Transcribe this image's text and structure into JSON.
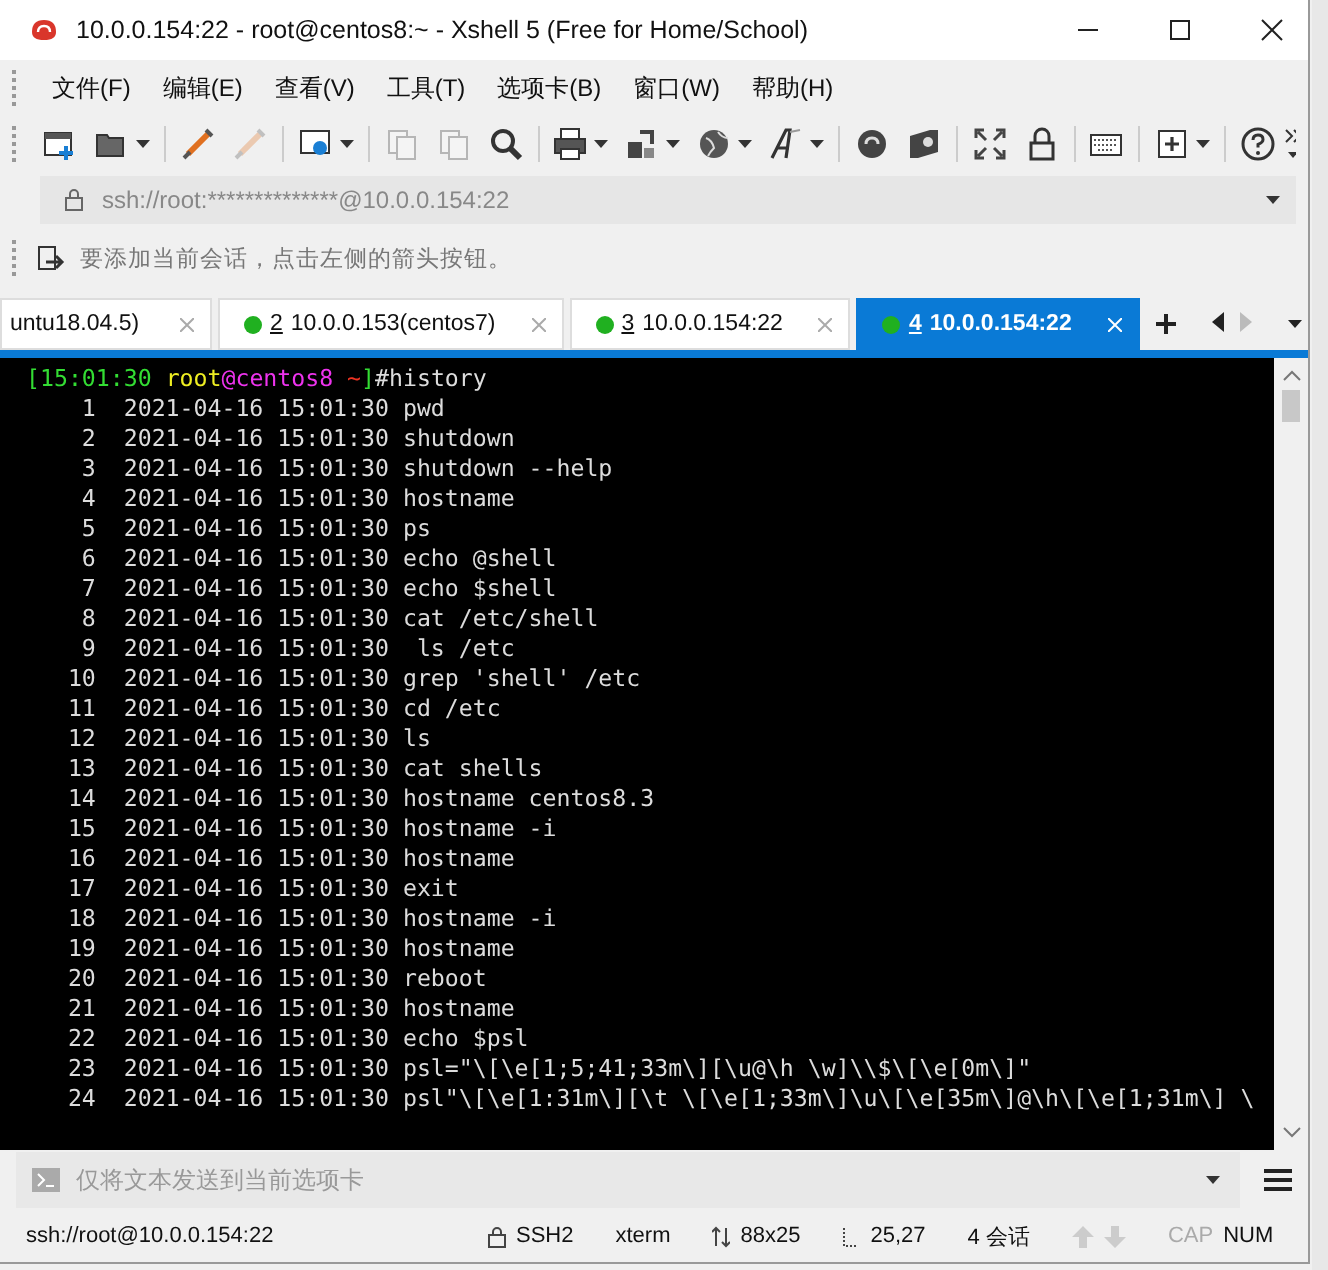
{
  "window": {
    "title": "10.0.0.154:22 - root@centos8:~ - Xshell 5 (Free for Home/School)"
  },
  "menu": [
    "文件(F)",
    "编辑(E)",
    "查看(V)",
    "工具(T)",
    "选项卡(B)",
    "窗口(W)",
    "帮助(H)"
  ],
  "toolbar": [
    {
      "kind": "new",
      "caret": false,
      "disabled": false
    },
    {
      "kind": "open",
      "caret": true,
      "disabled": false
    },
    {
      "kind": "sep"
    },
    {
      "kind": "connect",
      "caret": false,
      "disabled": false
    },
    {
      "kind": "disconnect",
      "caret": false,
      "disabled": true
    },
    {
      "kind": "sep"
    },
    {
      "kind": "properties",
      "caret": true,
      "disabled": false
    },
    {
      "kind": "sep"
    },
    {
      "kind": "copy",
      "caret": false,
      "disabled": true
    },
    {
      "kind": "paste",
      "caret": false,
      "disabled": true
    },
    {
      "kind": "find",
      "caret": false,
      "disabled": false
    },
    {
      "kind": "sep"
    },
    {
      "kind": "print",
      "caret": true,
      "disabled": false
    },
    {
      "kind": "transfer",
      "caret": true,
      "disabled": false
    },
    {
      "kind": "globe",
      "caret": true,
      "disabled": false
    },
    {
      "kind": "font",
      "caret": true,
      "disabled": false
    },
    {
      "kind": "sep"
    },
    {
      "kind": "shell",
      "caret": false,
      "disabled": false
    },
    {
      "kind": "xftp",
      "caret": false,
      "disabled": false
    },
    {
      "kind": "sep"
    },
    {
      "kind": "fullscreen",
      "caret": false,
      "disabled": false
    },
    {
      "kind": "lock",
      "caret": false,
      "disabled": false
    },
    {
      "kind": "sep"
    },
    {
      "kind": "keyboard",
      "caret": false,
      "disabled": false
    },
    {
      "kind": "sep"
    },
    {
      "kind": "newtab",
      "caret": true,
      "disabled": false
    },
    {
      "kind": "sep"
    },
    {
      "kind": "help",
      "caret": false,
      "disabled": false
    }
  ],
  "address_bar": {
    "value": "ssh://root:**************@10.0.0.154:22"
  },
  "hint_bar": {
    "text": "要添加当前会话，点击左侧的箭头按钮。"
  },
  "tabs": [
    {
      "label": "untu18.04.5)",
      "selected": false,
      "connected": false
    },
    {
      "number": "2",
      "label": "10.0.0.153(centos7)",
      "selected": false,
      "connected": true
    },
    {
      "number": "3",
      "label": "10.0.0.154:22",
      "selected": false,
      "connected": true
    },
    {
      "number": "4",
      "label": "10.0.0.154:22",
      "selected": true,
      "connected": true
    }
  ],
  "terminal": {
    "prompt": [
      {
        "text": "[15:01:30 ",
        "color": "#33dd33"
      },
      {
        "text": "root",
        "color": "#eeee22"
      },
      {
        "text": "@centos8",
        "color": "#ee33ee"
      },
      {
        "text": " ~",
        "color": "#ee3322"
      },
      {
        "text": "]",
        "color": "#33dd33"
      },
      {
        "text": "#history",
        "color": "#dddddd"
      }
    ],
    "rows": [
      {
        "number": "1",
        "timestamp": "2021-04-16 15:01:30",
        "command": "pwd"
      },
      {
        "number": "2",
        "timestamp": "2021-04-16 15:01:30",
        "command": "shutdown"
      },
      {
        "number": "3",
        "timestamp": "2021-04-16 15:01:30",
        "command": "shutdown --help"
      },
      {
        "number": "4",
        "timestamp": "2021-04-16 15:01:30",
        "command": "hostname"
      },
      {
        "number": "5",
        "timestamp": "2021-04-16 15:01:30",
        "command": "ps"
      },
      {
        "number": "6",
        "timestamp": "2021-04-16 15:01:30",
        "command": "echo @shell"
      },
      {
        "number": "7",
        "timestamp": "2021-04-16 15:01:30",
        "command": "echo $shell"
      },
      {
        "number": "8",
        "timestamp": "2021-04-16 15:01:30",
        "command": "cat /etc/shell"
      },
      {
        "number": "9",
        "timestamp": "2021-04-16 15:01:30",
        "command": " ls /etc"
      },
      {
        "number": "10",
        "timestamp": "2021-04-16 15:01:30",
        "command": "grep 'shell' /etc"
      },
      {
        "number": "11",
        "timestamp": "2021-04-16 15:01:30",
        "command": "cd /etc"
      },
      {
        "number": "12",
        "timestamp": "2021-04-16 15:01:30",
        "command": "ls"
      },
      {
        "number": "13",
        "timestamp": "2021-04-16 15:01:30",
        "command": "cat shells"
      },
      {
        "number": "14",
        "timestamp": "2021-04-16 15:01:30",
        "command": "hostname centos8.3"
      },
      {
        "number": "15",
        "timestamp": "2021-04-16 15:01:30",
        "command": "hostname -i"
      },
      {
        "number": "16",
        "timestamp": "2021-04-16 15:01:30",
        "command": "hostname"
      },
      {
        "number": "17",
        "timestamp": "2021-04-16 15:01:30",
        "command": "exit"
      },
      {
        "number": "18",
        "timestamp": "2021-04-16 15:01:30",
        "command": "hostname -i"
      },
      {
        "number": "19",
        "timestamp": "2021-04-16 15:01:30",
        "command": "hostname"
      },
      {
        "number": "20",
        "timestamp": "2021-04-16 15:01:30",
        "command": "reboot"
      },
      {
        "number": "21",
        "timestamp": "2021-04-16 15:01:30",
        "command": "hostname"
      },
      {
        "number": "22",
        "timestamp": "2021-04-16 15:01:30",
        "command": "echo $psl"
      },
      {
        "number": "23",
        "timestamp": "2021-04-16 15:01:30",
        "command": "psl=\"\\[\\e[1;5;41;33m\\][\\u@\\h \\w]\\\\$\\[\\e[0m\\]\""
      },
      {
        "number": "24",
        "timestamp": "2021-04-16 15:01:30",
        "command": "psl\"\\[\\e[1:31m\\][\\t \\[\\e[1;33m\\]\\u\\[\\e[35m\\]@\\h\\[\\e[1;31m\\] \\"
      }
    ]
  },
  "send_bar": {
    "placeholder": "仅将文本发送到当前选项卡"
  },
  "status_bar": {
    "address": "ssh://root@10.0.0.154:22",
    "protocol": "SSH2",
    "terminal_type": "xterm",
    "size": "88x25",
    "cursor": "25,27",
    "sessions": "4 会话",
    "caps_lock": false,
    "num_lock": true,
    "caps_label": "CAP",
    "num_label": "NUM"
  }
}
